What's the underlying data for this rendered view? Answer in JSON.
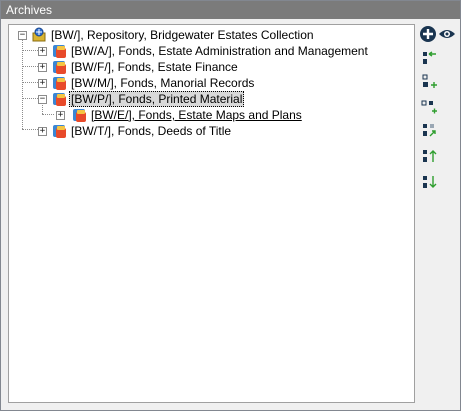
{
  "panel": {
    "title": "Archives"
  },
  "tree": {
    "root": {
      "label": "[BW/], Repository, Bridgewater Estates Collection",
      "expanded": true
    },
    "items": [
      {
        "label": "[BW/A/], Fonds, Estate Administration and Management",
        "expanded": false
      },
      {
        "label": "[BW/F/], Fonds, Estate Finance",
        "expanded": false
      },
      {
        "label": "[BW/M/], Fonds, Manorial Records",
        "expanded": false
      },
      {
        "label": "[BW/P/], Fonds, Printed Material",
        "expanded": true,
        "selected": true
      },
      {
        "label": "[BW/E/], Fonds, Estate Maps and Plans",
        "expanded": false,
        "child_of": "[BW/P/]"
      },
      {
        "label": "[BW/T/], Fonds, Deeds of Title",
        "expanded": false
      }
    ]
  },
  "toolbar": {
    "buttons": [
      "add-icon",
      "view-icon",
      "move-left-icon",
      "add-child-icon",
      "add-sibling-icon",
      "replace-icon",
      "move-up-icon",
      "move-down-icon"
    ]
  },
  "colors": {
    "header_bg": "#7b7b7b",
    "selection_bg": "#d9d9d9",
    "tree_bg": "#ffffff",
    "toolbar_accent": "#2e9e2e"
  }
}
